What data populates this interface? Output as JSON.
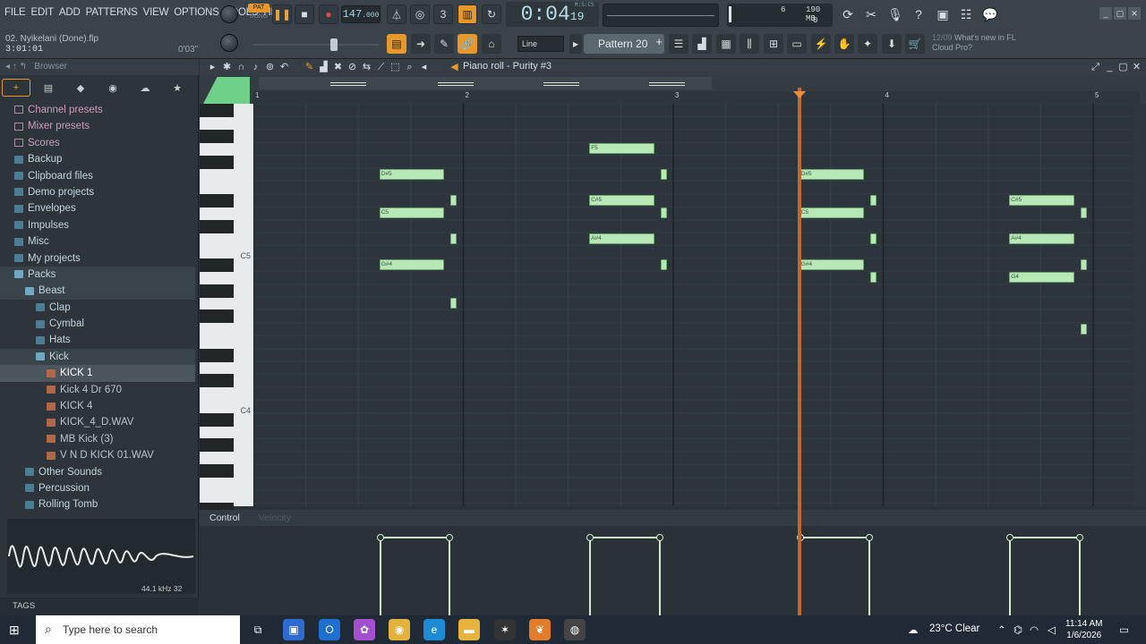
{
  "menu": [
    "FILE",
    "EDIT",
    "ADD",
    "PATTERNS",
    "VIEW",
    "OPTIONS",
    "TOOLS",
    "HELP"
  ],
  "song": {
    "name": "02. Nyikelani (Done).flp",
    "position": "3:01:01",
    "length": "0'03\""
  },
  "transport": {
    "pat_label": "PAT",
    "song_label": "SONG",
    "tempo": "147",
    "tempo_decimals": ".000",
    "time_main": "0:04",
    "time_sub": "19",
    "time_unit": "M:S:CS"
  },
  "cpu": {
    "value1": "6",
    "memory": "190 MB",
    "value2": "0"
  },
  "toolbar2": {
    "snap": "Line",
    "pattern": "Pattern 20"
  },
  "news": {
    "date": "12/09",
    "text1": "What's new in FL",
    "text2": "Cloud Pro?"
  },
  "browser": {
    "header": "Browser",
    "items": [
      {
        "label": "Channel presets",
        "type": "preset"
      },
      {
        "label": "Mixer presets",
        "type": "preset"
      },
      {
        "label": "Scores",
        "type": "preset"
      },
      {
        "label": "Backup",
        "type": "folder"
      },
      {
        "label": "Clipboard files",
        "type": "folder"
      },
      {
        "label": "Demo projects",
        "type": "folder"
      },
      {
        "label": "Envelopes",
        "type": "folder"
      },
      {
        "label": "Impulses",
        "type": "folder"
      },
      {
        "label": "Misc",
        "type": "folder"
      },
      {
        "label": "My projects",
        "type": "folder"
      },
      {
        "label": "Packs",
        "type": "open"
      },
      {
        "label": "Beast",
        "type": "open"
      },
      {
        "label": "Clap",
        "type": "folder"
      },
      {
        "label": "Cymbal",
        "type": "folder"
      },
      {
        "label": "Hats",
        "type": "folder"
      },
      {
        "label": "Kick",
        "type": "open"
      },
      {
        "label": "KICK 1",
        "type": "selected"
      },
      {
        "label": "Kick 4 Dr 670",
        "type": "file"
      },
      {
        "label": "KICK 4",
        "type": "file"
      },
      {
        "label": "KICK_4_D.WAV",
        "type": "file"
      },
      {
        "label": "MB Kick (3)",
        "type": "file"
      },
      {
        "label": "V N D KICK 01.WAV",
        "type": "file"
      },
      {
        "label": "Other Sounds",
        "type": "folder"
      },
      {
        "label": "Percussion",
        "type": "folder"
      },
      {
        "label": "Rolling Tomb",
        "type": "folder"
      }
    ],
    "sample_info": "44.1 kHz 32",
    "tags_label": "TAGS"
  },
  "piano_roll": {
    "title": "Piano roll - Purity #3",
    "bars": [
      "1",
      "2",
      "3",
      "4",
      "5"
    ],
    "key_labels": [
      "C5",
      "C4"
    ],
    "control_label": "Control",
    "control_param": "Velocity",
    "notes": [
      {
        "label": "D#5",
        "bar": 1.6,
        "len": 0.31,
        "row": 5
      },
      {
        "label": "C5",
        "bar": 1.6,
        "len": 0.31,
        "row": 8
      },
      {
        "label": "G#4",
        "bar": 1.6,
        "len": 0.31,
        "row": 12
      },
      {
        "label": "",
        "bar": 1.94,
        "len": 0.03,
        "row": 7
      },
      {
        "label": "",
        "bar": 1.94,
        "len": 0.03,
        "row": 10
      },
      {
        "label": "",
        "bar": 1.94,
        "len": 0.03,
        "row": 15
      },
      {
        "label": "F5",
        "bar": 2.6,
        "len": 0.31,
        "row": 3
      },
      {
        "label": "C#5",
        "bar": 2.6,
        "len": 0.31,
        "row": 7
      },
      {
        "label": "A#4",
        "bar": 2.6,
        "len": 0.31,
        "row": 10
      },
      {
        "label": "",
        "bar": 2.94,
        "len": 0.03,
        "row": 5
      },
      {
        "label": "",
        "bar": 2.94,
        "len": 0.03,
        "row": 8
      },
      {
        "label": "",
        "bar": 2.94,
        "len": 0.03,
        "row": 12
      },
      {
        "label": "D#5",
        "bar": 3.6,
        "len": 0.31,
        "row": 5
      },
      {
        "label": "C5",
        "bar": 3.6,
        "len": 0.31,
        "row": 8
      },
      {
        "label": "G#4",
        "bar": 3.6,
        "len": 0.31,
        "row": 12
      },
      {
        "label": "",
        "bar": 3.94,
        "len": 0.03,
        "row": 7
      },
      {
        "label": "",
        "bar": 3.94,
        "len": 0.03,
        "row": 10
      },
      {
        "label": "",
        "bar": 3.94,
        "len": 0.03,
        "row": 13
      },
      {
        "label": "C#5",
        "bar": 4.6,
        "len": 0.31,
        "row": 7
      },
      {
        "label": "A#4",
        "bar": 4.6,
        "len": 0.31,
        "row": 10
      },
      {
        "label": "G4",
        "bar": 4.6,
        "len": 0.31,
        "row": 13
      },
      {
        "label": "",
        "bar": 4.94,
        "len": 0.03,
        "row": 8
      },
      {
        "label": "",
        "bar": 4.94,
        "len": 0.03,
        "row": 12
      },
      {
        "label": "",
        "bar": 4.94,
        "len": 0.03,
        "row": 17
      }
    ],
    "playhead_bar": 3.6
  },
  "taskbar": {
    "search_placeholder": "Type here to search",
    "weather": "23°C  Clear",
    "time": "11:14 AM",
    "date": "1/6/2026"
  }
}
